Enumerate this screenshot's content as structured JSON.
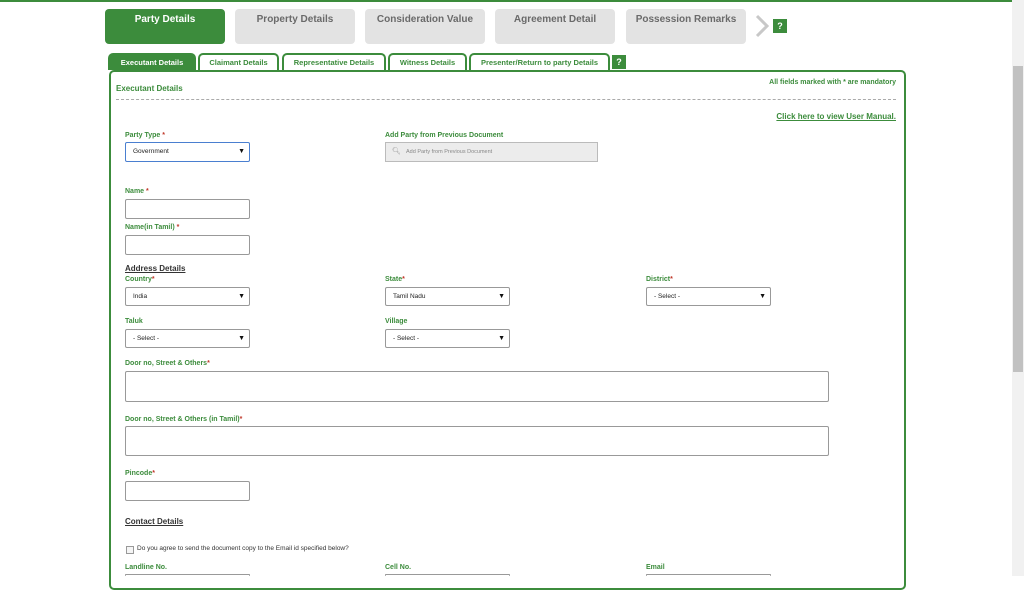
{
  "main_tabs": [
    {
      "label": "Party Details"
    },
    {
      "label": "Property Details"
    },
    {
      "label": "Consideration Value"
    },
    {
      "label": "Agreement Detail"
    },
    {
      "label": "Possession Remarks"
    }
  ],
  "help": "?",
  "sub_tabs": [
    {
      "label": "Executant Details"
    },
    {
      "label": "Claimant Details"
    },
    {
      "label": "Representative Details"
    },
    {
      "label": "Witness Details"
    },
    {
      "label": "Presenter/Return to party Details"
    }
  ],
  "section": {
    "title": "Executant Details",
    "mandatory_note": "All fields marked with * are mandatory",
    "manual_link": "Click here to view User Manual."
  },
  "form": {
    "party_type_label": "Party Type",
    "party_type_value": "Government",
    "add_party_label": "Add Party from Previous Document",
    "add_party_placeholder": "Add Party from Previous Document",
    "name_label": "Name",
    "name_tamil_label": "Name(in Tamil)",
    "address_heading": "Address Details",
    "country_label": "Country",
    "country_value": "India",
    "state_label": "State",
    "state_value": "Tamil Nadu",
    "district_label": "District",
    "district_value": "- Select -",
    "taluk_label": "Taluk",
    "taluk_value": "- Select -",
    "village_label": "Village",
    "village_value": "- Select -",
    "door_label": "Door no, Street & Others",
    "door_tamil_label": "Door no, Street & Others (in Tamil)",
    "pincode_label": "Pincode",
    "contact_heading": "Contact Details",
    "email_consent": "Do you agree to send the document copy to the Email id specified below?",
    "landline_label": "Landline No.",
    "cell_label": "Cell No.",
    "email_label": "Email",
    "required_mark": "*"
  },
  "caret": "▼",
  "icons": {
    "search": "search-icon",
    "chevron": "chevron-right-icon"
  },
  "colors": {
    "accent": "#3c8c3c",
    "required": "#c0392b"
  }
}
